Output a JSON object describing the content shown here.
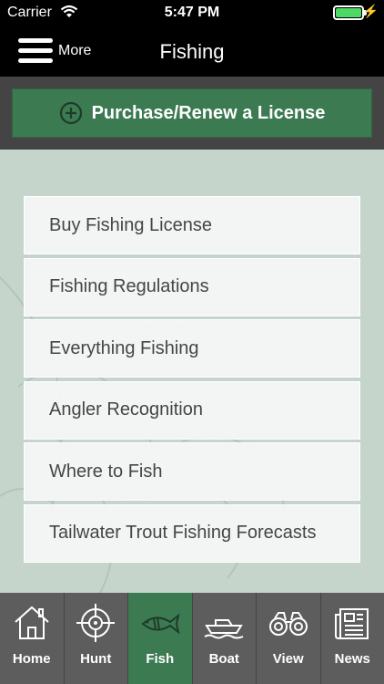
{
  "status_bar": {
    "carrier": "Carrier",
    "time": "5:47 PM",
    "battery_color": "#4cd964"
  },
  "nav": {
    "menu_label": "More",
    "title": "Fishing"
  },
  "license_button": {
    "label": "Purchase/Renew a License",
    "icon": "plus-circle-icon",
    "color": "#3c7a52"
  },
  "menu": {
    "items": [
      {
        "label": "Buy Fishing License"
      },
      {
        "label": "Fishing Regulations"
      },
      {
        "label": "Everything Fishing"
      },
      {
        "label": "Angler Recognition"
      },
      {
        "label": "Where to Fish"
      },
      {
        "label": "Tailwater Trout Fishing Forecasts"
      }
    ]
  },
  "tabs": [
    {
      "label": "Home",
      "icon": "house-icon",
      "active": false
    },
    {
      "label": "Hunt",
      "icon": "crosshair-icon",
      "active": false
    },
    {
      "label": "Fish",
      "icon": "fish-icon",
      "active": true
    },
    {
      "label": "Boat",
      "icon": "boat-icon",
      "active": false
    },
    {
      "label": "View",
      "icon": "binoculars-icon",
      "active": false
    },
    {
      "label": "News",
      "icon": "newspaper-icon",
      "active": false
    }
  ]
}
